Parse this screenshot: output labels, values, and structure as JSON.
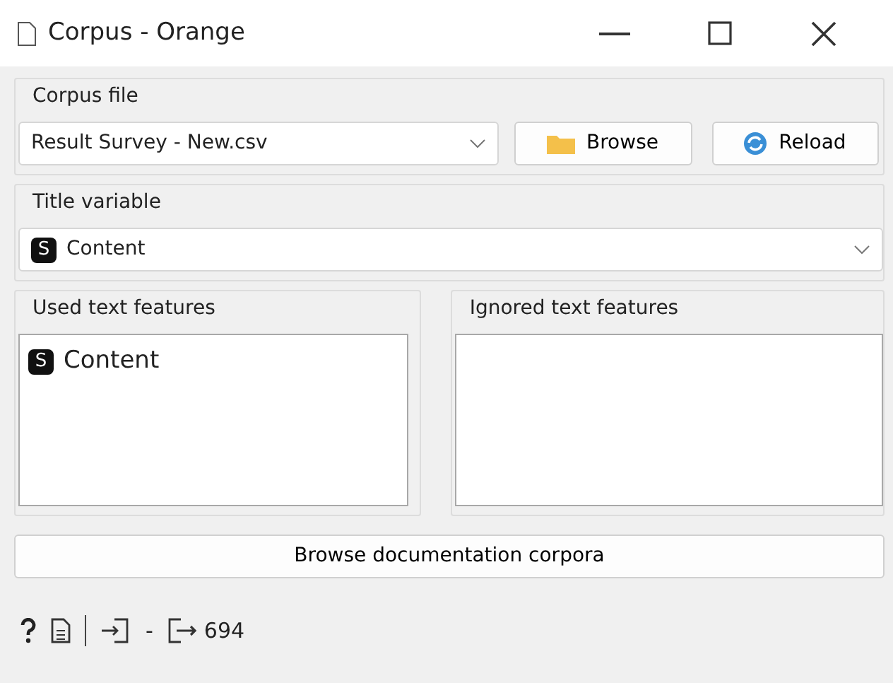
{
  "window": {
    "title": "Corpus - Orange"
  },
  "corpus_file": {
    "label": "Corpus file",
    "value": "Result Survey - New.csv",
    "buttons": [
      "Browse",
      "Reload"
    ]
  },
  "title_variable": {
    "label": "Title variable",
    "type_badge": "S",
    "value": "Content"
  },
  "used_features": {
    "label": "Used text features",
    "items": [
      {
        "type_badge": "S",
        "name": "Content"
      }
    ]
  },
  "ignored_features": {
    "label": "Ignored text features"
  },
  "documentation_button": "Browse documentation corpora",
  "status_bar": {
    "input_count": "-",
    "output_count": "694"
  }
}
